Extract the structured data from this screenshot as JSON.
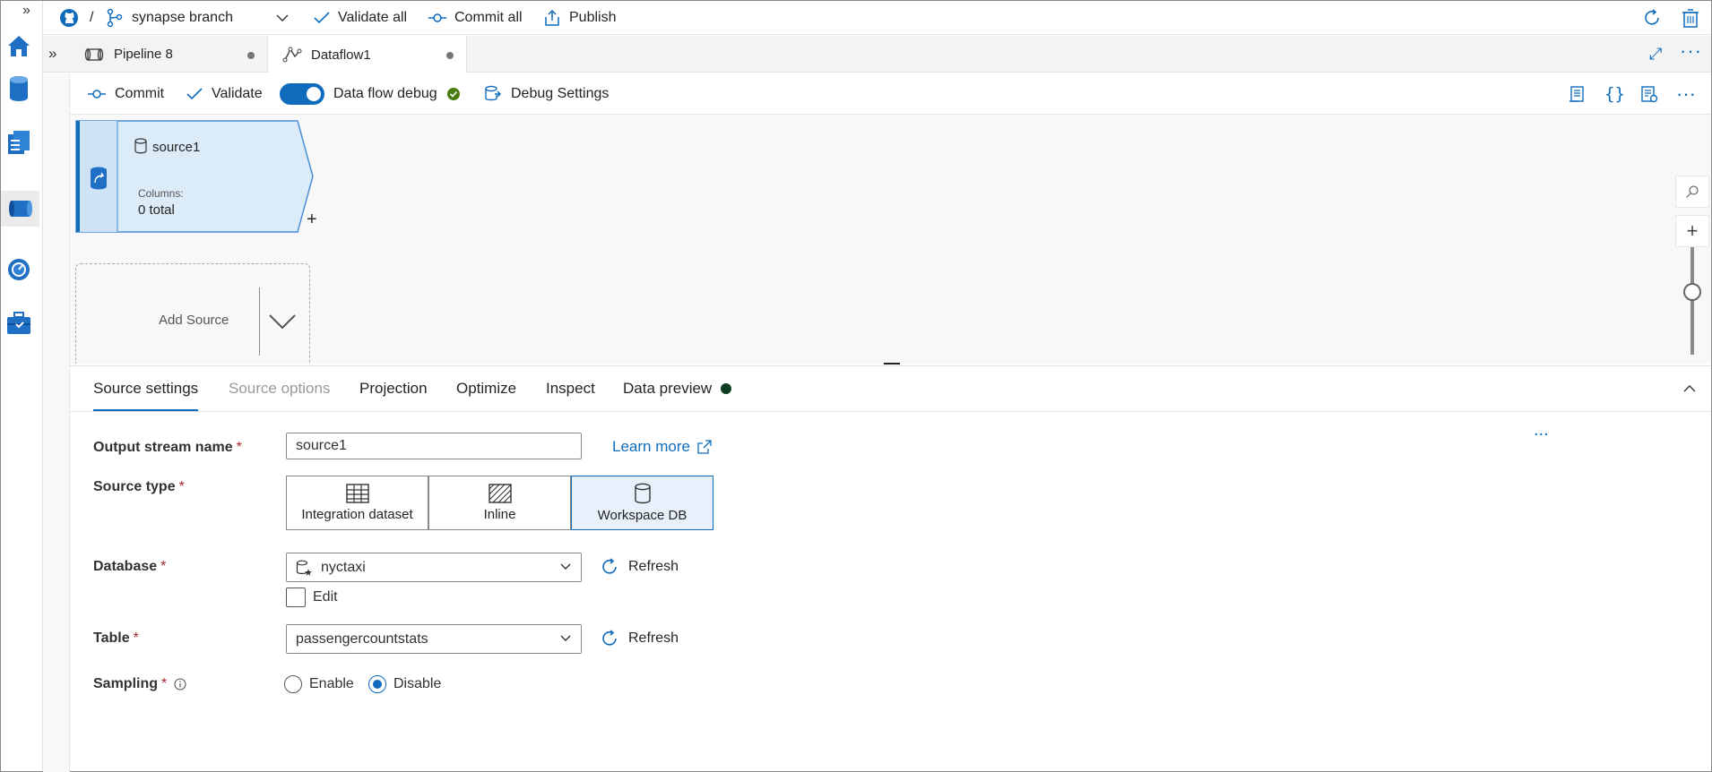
{
  "topbar": {
    "separator": "/",
    "branch": "synapse branch",
    "validate_all": "Validate all",
    "commit_all": "Commit all",
    "publish": "Publish"
  },
  "tabs": [
    {
      "label": "Pipeline 8",
      "icon": "pipeline-icon"
    },
    {
      "label": "Dataflow1",
      "icon": "dataflow-icon"
    }
  ],
  "toolbar": {
    "commit": "Commit",
    "validate": "Validate",
    "data_flow_debug": "Data flow debug",
    "debug_settings": "Debug Settings",
    "debug_on": true
  },
  "canvas": {
    "node": {
      "name": "source1",
      "columns_label": "Columns:",
      "columns_value": "0 total"
    },
    "add_source": "Add Source"
  },
  "panel": {
    "tabs": [
      "Source settings",
      "Source options",
      "Projection",
      "Optimize",
      "Inspect",
      "Data preview"
    ],
    "active_tab": "Source settings",
    "output_stream_label": "Output stream name",
    "output_stream_value": "source1",
    "learn_more": "Learn more",
    "source_type_label": "Source type",
    "source_types": [
      "Integration dataset",
      "Inline",
      "Workspace DB"
    ],
    "selected_source_type": "Workspace DB",
    "database_label": "Database",
    "database_value": "nyctaxi",
    "edit_label": "Edit",
    "refresh": "Refresh",
    "table_label": "Table",
    "table_value": "passengercountstats",
    "sampling_label": "Sampling",
    "enable": "Enable",
    "disable": "Disable",
    "sampling_value": "Disable",
    "required_mark": "*",
    "more": "..."
  },
  "colors": {
    "accent": "#0f6cbd",
    "node_fill": "#dcebf8",
    "status_green": "#4a7c12"
  }
}
